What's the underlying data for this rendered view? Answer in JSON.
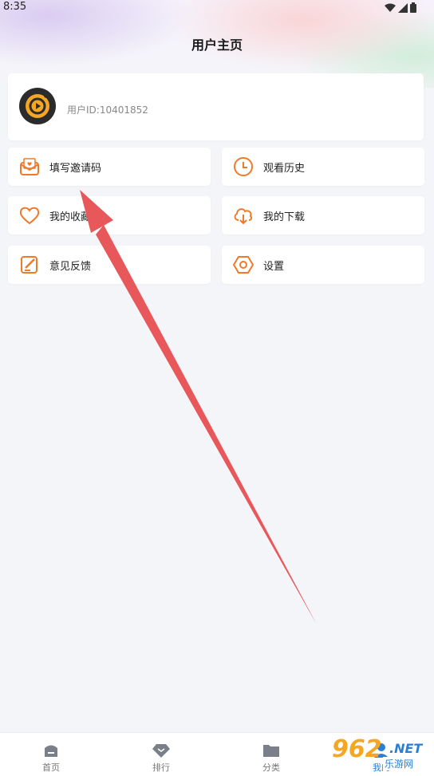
{
  "status_bar": {
    "time": "8:35"
  },
  "page": {
    "title": "用户主页"
  },
  "profile": {
    "user_id": "用户ID:10401852"
  },
  "menu": [
    {
      "label": "填写邀请码",
      "icon": "mail-heart-icon"
    },
    {
      "label": "观看历史",
      "icon": "clock-icon"
    },
    {
      "label": "我的收藏",
      "icon": "heart-icon"
    },
    {
      "label": "我的下载",
      "icon": "cloud-download-icon"
    },
    {
      "label": "意见反馈",
      "icon": "edit-note-icon"
    },
    {
      "label": "设置",
      "icon": "hexagon-settings-icon"
    }
  ],
  "bottom_nav": [
    {
      "label": "首页",
      "icon": "home-icon"
    },
    {
      "label": "排行",
      "icon": "diamond-icon"
    },
    {
      "label": "分类",
      "icon": "folder-icon"
    },
    {
      "label": "我的",
      "icon": "user-icon"
    }
  ],
  "watermark": {
    "text": "962",
    "suffix": ".NET",
    "cn": "乐游网"
  },
  "colors": {
    "accent": "#f07a2a",
    "arrow": "#e8575a"
  }
}
